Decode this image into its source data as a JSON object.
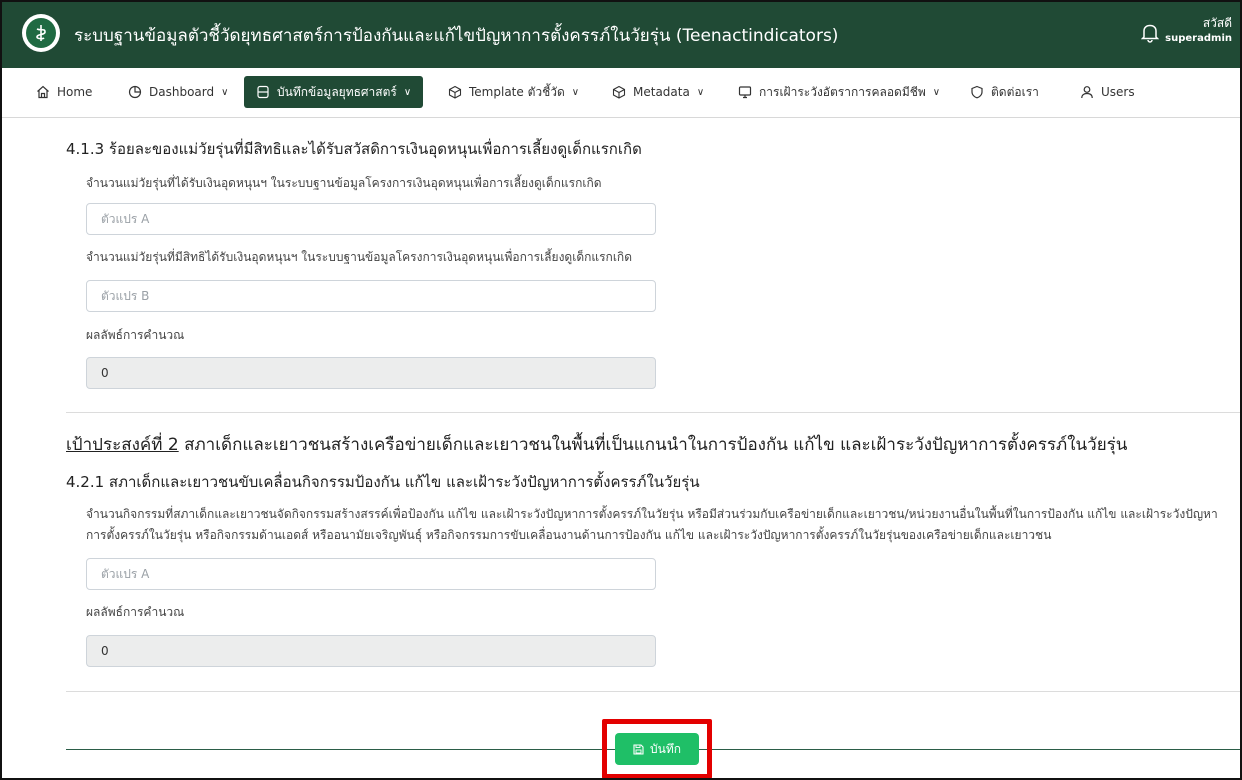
{
  "header": {
    "title": "ระบบฐานข้อมูลตัวชี้วัดยุทธศาสตร์การป้องกันและแก้ไขปัญหาการตั้งครรภ์ในวัยรุ่น (Teenactindicators)",
    "greeting": "สวัสดี",
    "role": "superadmin"
  },
  "nav": [
    {
      "label": "Home",
      "icon": "home-icon"
    },
    {
      "label": "Dashboard",
      "icon": "pie-chart-icon"
    },
    {
      "label": "บันทึกข้อมูลยุทธศาสตร์",
      "icon": "database-icon"
    },
    {
      "label": "Template ตัวชี้วัด",
      "icon": "box-icon"
    },
    {
      "label": "Metadata",
      "icon": "box-icon"
    },
    {
      "label": "การเฝ้าระวังอัตราการคลอดมีชีพ",
      "icon": "monitor-icon"
    },
    {
      "label": "ติดต่อเรา",
      "icon": "shield-icon"
    },
    {
      "label": "Users",
      "icon": "user-icon"
    }
  ],
  "section_413": {
    "title": "4.1.3 ร้อยละของแม่วัยรุ่นที่มีสิทธิและได้รับสวัสดิการเงินอุดหนุนเพื่อการเลี้ยงดูเด็กแรกเกิด",
    "label_a": "จำนวนแม่วัยรุ่นที่ได้รับเงินอุดหนุนฯ ในระบบฐานข้อมูลโครงการเงินอุดหนุนเพื่อการเลี้ยงดูเด็กแรกเกิด",
    "placeholder_a": "ตัวแปร A",
    "label_b": "จำนวนแม่วัยรุ่นที่มีสิทธิได้รับเงินอุดหนุนฯ ในระบบฐานข้อมูลโครงการเงินอุดหนุนเพื่อการเลี้ยงดูเด็กแรกเกิด",
    "placeholder_b": "ตัวแปร B",
    "result_label": "ผลลัพธ์การคำนวณ",
    "result_value": "0"
  },
  "goal2": {
    "prefix": "เป้าประสงค์ที่ 2",
    "text": " สภาเด็กและเยาวชนสร้างเครือข่ายเด็กและเยาวชนในพื้นที่เป็นแกนนำในการป้องกัน แก้ไข และเฝ้าระวังปัญหาการตั้งครรภ์ในวัยรุ่น"
  },
  "section_421": {
    "title": "4.2.1 สภาเด็กและเยาวชนขับเคลื่อนกิจกรรมป้องกัน แก้ไข และเฝ้าระวังปัญหาการตั้งครรภ์ในวัยรุ่น",
    "label_a": "จำนวนกิจกรรมที่สภาเด็กและเยาวชนจัดกิจกรรมสร้างสรรค์เพื่อป้องกัน แก้ไข และเฝ้าระวังปัญหาการตั้งครรภ์ในวัยรุ่น หรือมีส่วนร่วมกับเครือข่ายเด็กและเยาวชน/หน่วยงานอื่นในพื้นที่ในการป้องกัน แก้ไข และเฝ้าระวังปัญหาการตั้งครรภ์ในวัยรุ่น หรือกิจกรรมด้านเอดส์ หรืออนามัยเจริญพันธุ์ หรือกิจกรรมการขับเคลื่อนงานด้านการป้องกัน แก้ไข และเฝ้าระวังปัญหาการตั้งครรภ์ในวัยรุ่นของเครือข่ายเด็กและเยาวชน",
    "placeholder_a": "ตัวแปร A",
    "result_label": "ผลลัพธ์การคำนวณ",
    "result_value": "0"
  },
  "save_label": "บันทึก",
  "colors": {
    "header_bg": "#204a35",
    "save_button": "#1fbf67",
    "highlight": "#e30000"
  }
}
